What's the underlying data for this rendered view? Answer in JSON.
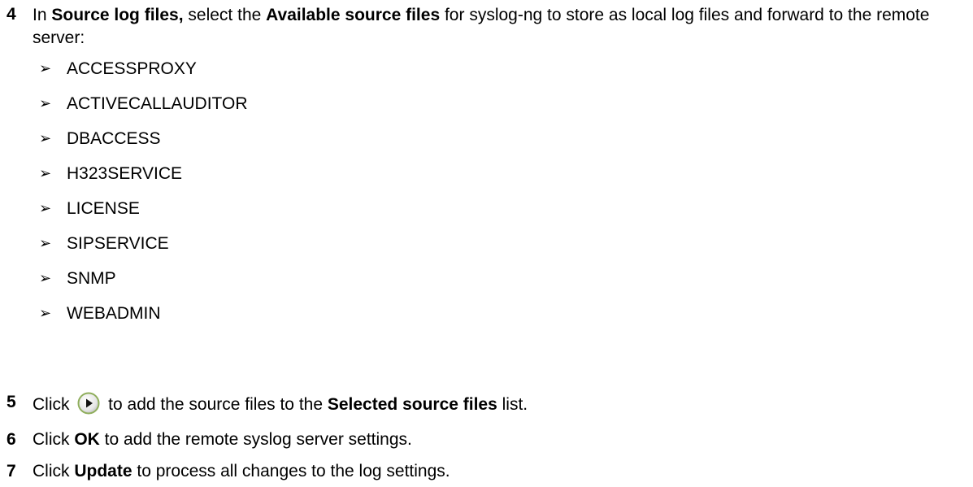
{
  "steps": [
    {
      "number": "4",
      "segments": [
        {
          "text": "In ",
          "bold": false
        },
        {
          "text": "Source log files,",
          "bold": true
        },
        {
          "text": " select the ",
          "bold": false
        },
        {
          "text": "Available source files",
          "bold": true
        },
        {
          "text": " for syslog-ng to store as local log files and forward to the remote server:",
          "bold": false
        }
      ],
      "bullets": [
        "ACCESSPROXY",
        "ACTIVECALLAUDITOR",
        "DBACCESS",
        "H323SERVICE",
        "LICENSE",
        "SIPSERVICE",
        "SNMP",
        "WEBADMIN"
      ]
    },
    {
      "number": "5",
      "before_icon": "Click ",
      "icon": "play-circle-icon",
      "after_icon": " to add the source files to the ",
      "bold_text": "Selected source files",
      "end_text": " list."
    },
    {
      "number": "6",
      "before_bold": "Click ",
      "bold_text": "OK",
      "end_text": " to add the remote syslog server settings."
    },
    {
      "number": "7",
      "before_bold": "Click ",
      "bold_text": "Update",
      "end_text": " to process all changes to the log settings."
    }
  ],
  "bullet_glyph": "➢"
}
